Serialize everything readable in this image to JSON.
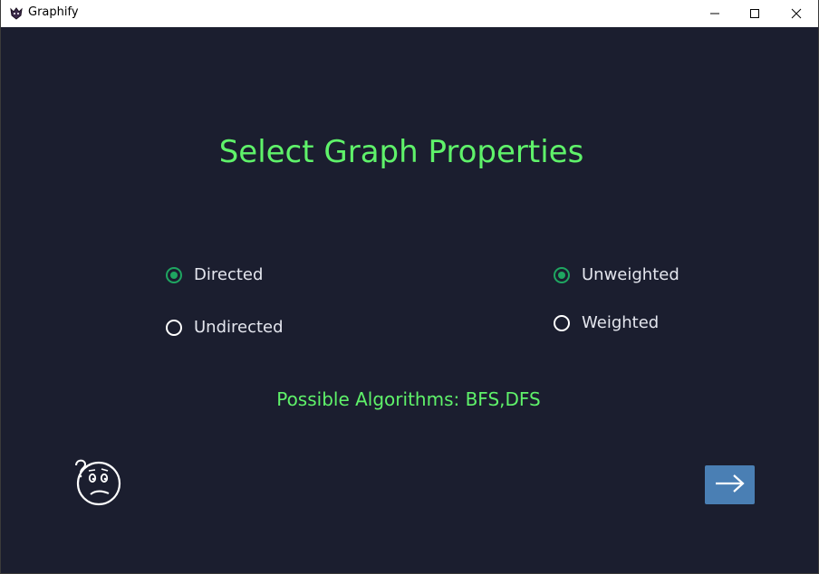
{
  "window": {
    "title": "Graphify",
    "icon": "graphify-app-icon",
    "controls": [
      "minimize-icon",
      "maximize-icon",
      "close-icon"
    ]
  },
  "main": {
    "heading": "Select Graph Properties",
    "direction_options": [
      {
        "label": "Directed",
        "checked": true
      },
      {
        "label": "Undirected",
        "checked": false
      }
    ],
    "weight_options": [
      {
        "label": "Unweighted",
        "checked": true
      },
      {
        "label": "Weighted",
        "checked": false
      }
    ],
    "possible_algorithms": "Possible Algorithms: BFS,DFS",
    "help_icon": "confused-face-icon",
    "next_icon": "arrow-right-icon"
  },
  "colors": {
    "background": "#1b1e2f",
    "accent_green": "#5ff26a",
    "radio_checked": "#1fa661",
    "button_blue": "#4a7fb4"
  }
}
